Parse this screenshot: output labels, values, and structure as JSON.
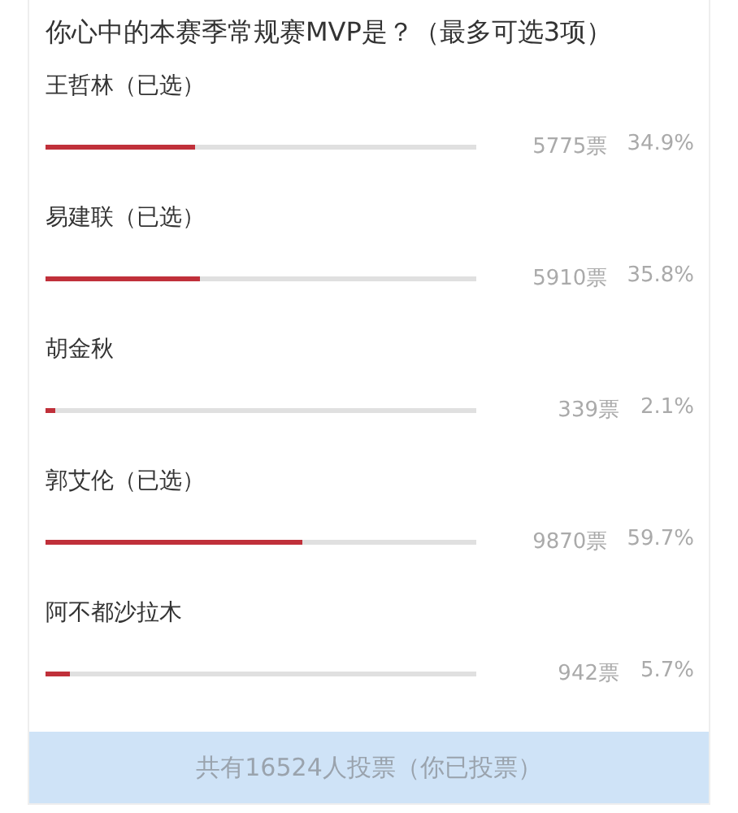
{
  "poll": {
    "question": "你心中的本赛季常规赛MVP是？（最多可选3项）",
    "options": [
      {
        "name": "王哲林（已选）",
        "level": 0.349,
        "votes": "5775票",
        "percent": "34.9%"
      },
      {
        "name": "易建联（已选）",
        "level": 0.358,
        "votes": "5910票",
        "percent": "35.8%"
      },
      {
        "name": "胡金秋",
        "level": 0.021,
        "votes": "339票",
        "percent": "2.1%"
      },
      {
        "name": "郭艾伦（已选）",
        "level": 0.597,
        "votes": "9870票",
        "percent": "59.7%"
      },
      {
        "name": "阿不都沙拉木",
        "level": 0.057,
        "votes": "942票",
        "percent": "5.7%"
      }
    ],
    "footer": "共有16524人投票（你已投票）"
  }
}
